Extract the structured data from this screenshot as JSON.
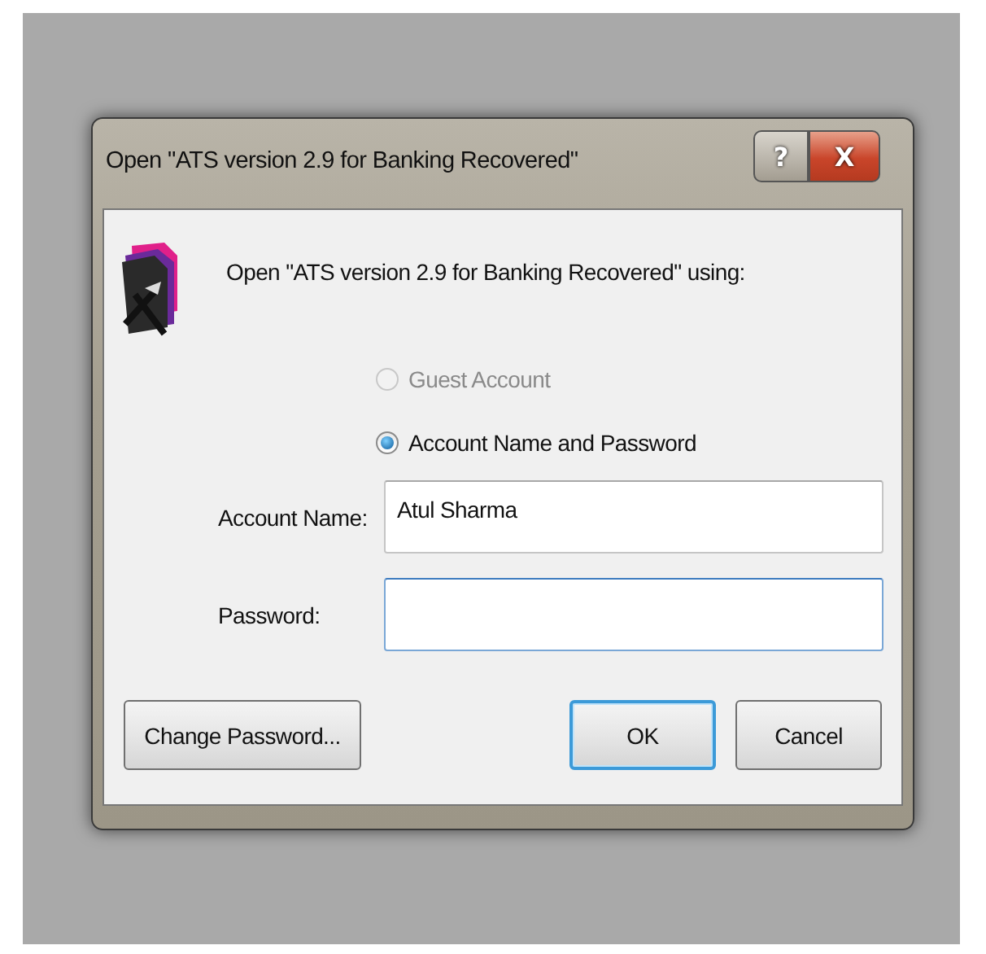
{
  "window": {
    "title": "Open \"ATS version 2.9 for Banking Recovered\"",
    "title_buttons": [
      {
        "label": "?",
        "kind": "help"
      },
      {
        "label": "X",
        "kind": "close"
      }
    ]
  },
  "heading": "Open \"ATS version 2.9 for Banking Recovered\" using:",
  "options": [
    {
      "label": "Guest Account",
      "selected": false,
      "disabled": true
    },
    {
      "label": "Account Name and Password",
      "selected": true,
      "disabled": false
    }
  ],
  "fields": [
    {
      "label": "Account Name:",
      "value": "Atul Sharma",
      "focused": false
    },
    {
      "label": "Password:",
      "focused": true
    }
  ],
  "buttons": [
    {
      "label": "Change Password...",
      "default": false
    },
    {
      "label": "OK",
      "default": true
    },
    {
      "label": "Cancel",
      "default": false
    }
  ]
}
